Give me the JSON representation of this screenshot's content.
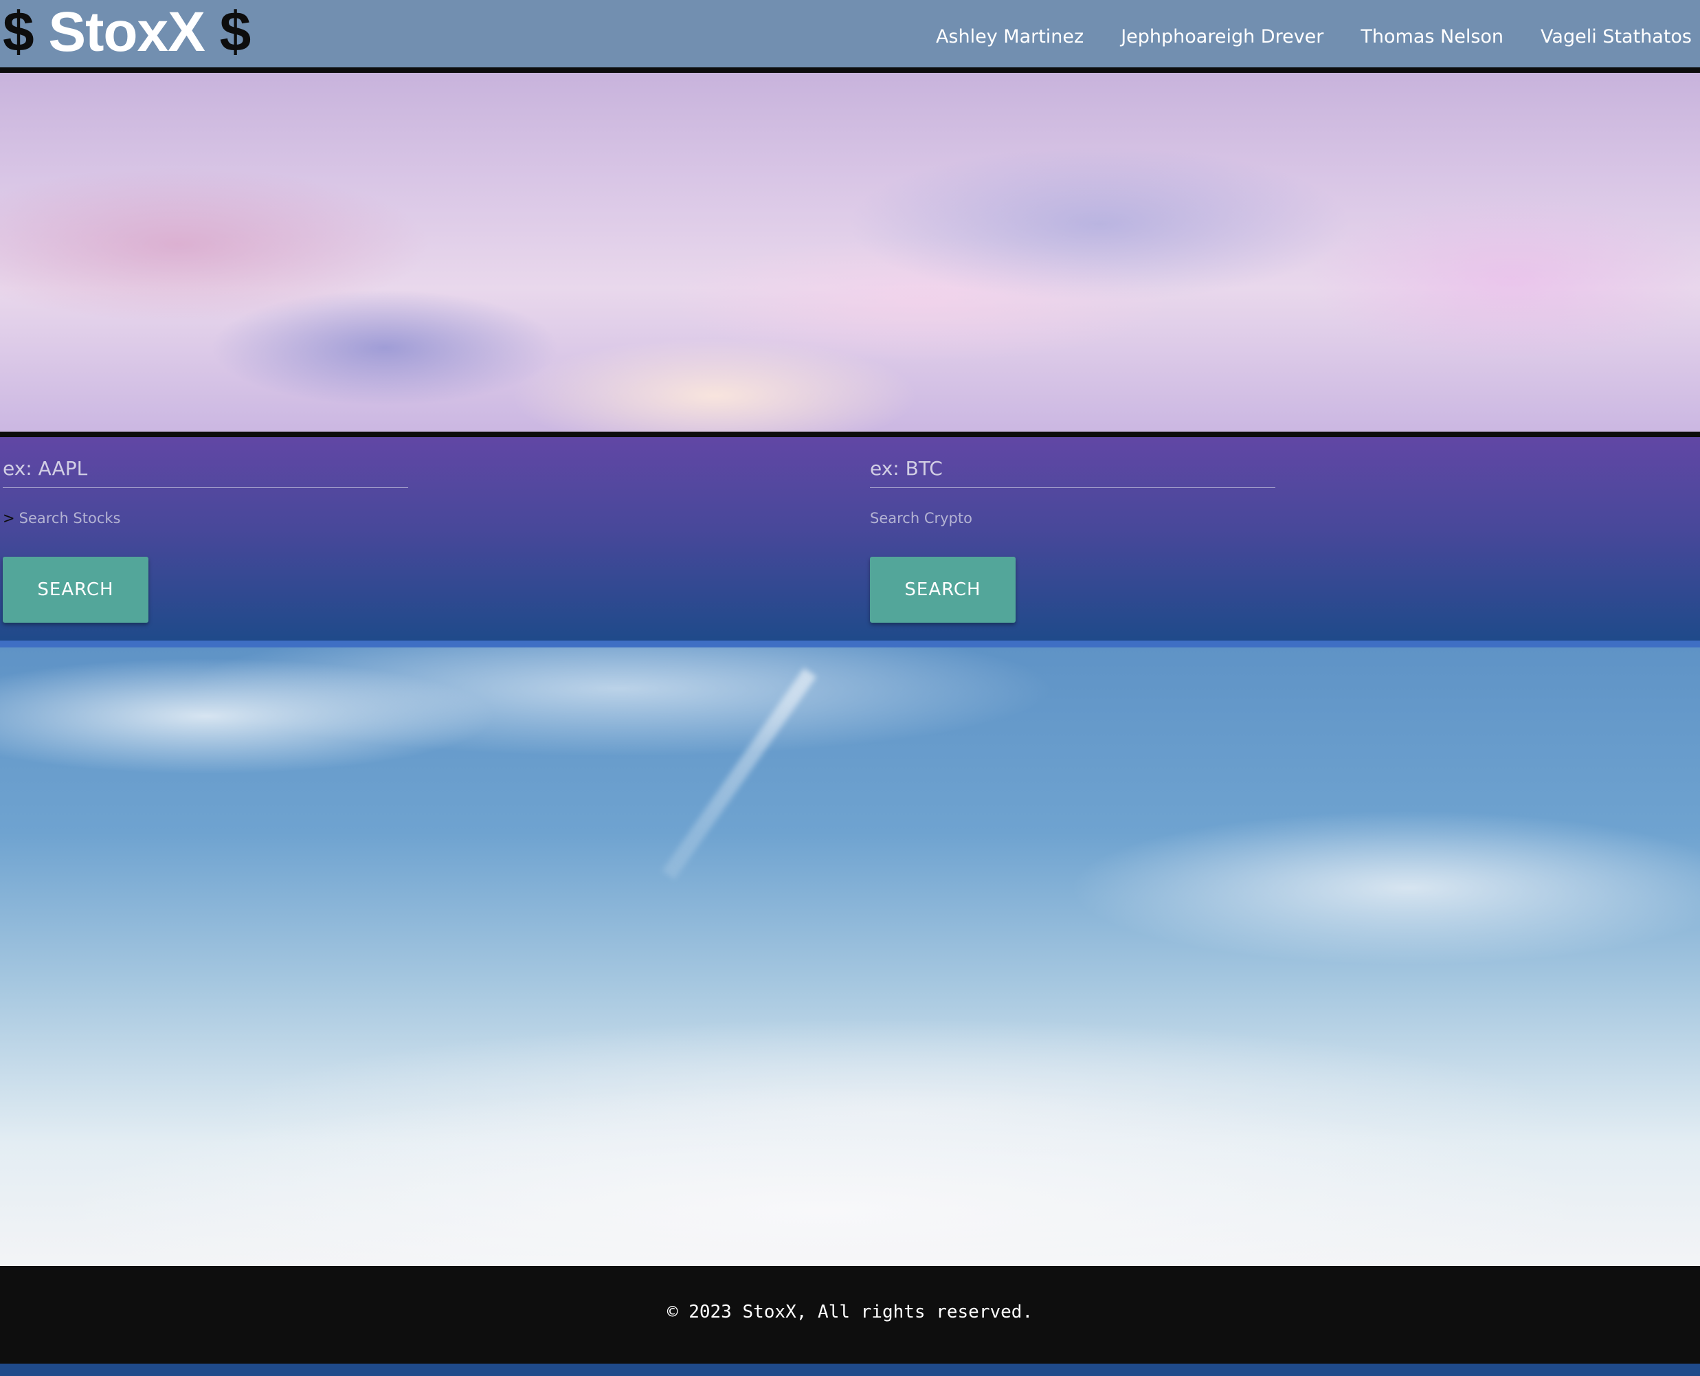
{
  "brand": {
    "left_symbol": "$",
    "name": "StoxX",
    "right_symbol": "$"
  },
  "nav": {
    "links": [
      {
        "label": "Ashley Martinez"
      },
      {
        "label": "Jephphoareigh Drever"
      },
      {
        "label": "Thomas Nelson"
      },
      {
        "label": "Vageli Stathatos"
      }
    ]
  },
  "search": {
    "stocks": {
      "placeholder": "ex: AAPL",
      "value": "",
      "caret": ">",
      "helper": "Search Stocks",
      "button_label": "SEARCH"
    },
    "crypto": {
      "placeholder": "ex: BTC",
      "value": "",
      "helper": "Search Crypto",
      "button_label": "SEARCH"
    }
  },
  "footer": {
    "text": "© 2023 StoxX, All rights reserved."
  },
  "colors": {
    "navbar_bg": "#728fb0",
    "panel_top": "#6147a5",
    "panel_bottom": "#1f4a8a",
    "button_bg": "#53a69a",
    "footer_bg": "#0e0e0e",
    "border": "#0c0c0c"
  }
}
